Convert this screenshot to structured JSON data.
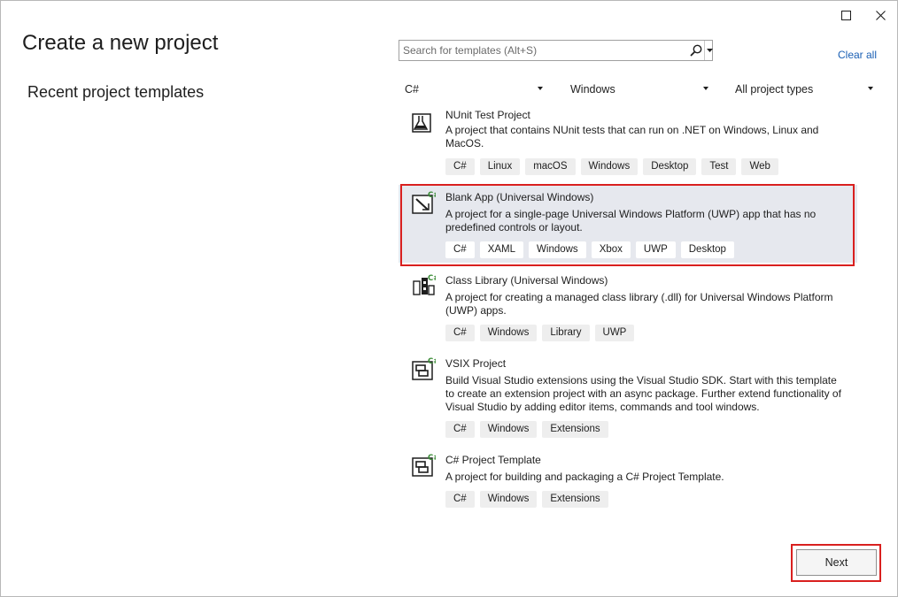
{
  "window": {
    "maximize_icon": "maximize-icon",
    "close_icon": "close-icon"
  },
  "header": {
    "title": "Create a new project"
  },
  "recent": {
    "title": "Recent project templates"
  },
  "search": {
    "placeholder": "Search for templates (Alt+S)",
    "icon": "search-icon"
  },
  "clear_all": "Clear all",
  "filters": {
    "language": "C#",
    "platform": "Windows",
    "project_type": "All project types"
  },
  "templates": [
    {
      "name": "NUnit Test Project",
      "description": "A project that contains NUnit tests that can run on .NET on Windows, Linux and MacOS.",
      "tags": [
        "C#",
        "Linux",
        "macOS",
        "Windows",
        "Desktop",
        "Test",
        "Web"
      ],
      "icon": "flask-icon"
    },
    {
      "name": "Blank App (Universal Windows)",
      "description": "A project for a single-page Universal Windows Platform (UWP) app that has no predefined controls or layout.",
      "tags": [
        "C#",
        "XAML",
        "Windows",
        "Xbox",
        "UWP",
        "Desktop"
      ],
      "icon": "uwp-app-icon",
      "badge": "C#",
      "selected": true
    },
    {
      "name": "Class Library (Universal Windows)",
      "description": "A project for creating a managed class library (.dll) for Universal Windows Platform (UWP) apps.",
      "tags": [
        "C#",
        "Windows",
        "Library",
        "UWP"
      ],
      "icon": "class-library-icon",
      "badge": "C#"
    },
    {
      "name": "VSIX Project",
      "description": "Build Visual Studio extensions using the Visual Studio SDK. Start with this template to create an extension project with an async package. Further extend functionality of Visual Studio by adding editor items, commands and tool windows.",
      "tags": [
        "C#",
        "Windows",
        "Extensions"
      ],
      "icon": "vsix-icon",
      "badge": "C#"
    },
    {
      "name": "C# Project Template",
      "description": "A project for building and packaging a C# Project Template.",
      "tags": [
        "C#",
        "Windows",
        "Extensions"
      ],
      "icon": "project-template-icon",
      "badge": "C#"
    }
  ],
  "footer": {
    "next_label": "Next"
  },
  "colors": {
    "accent_red": "#d9201f",
    "link_blue": "#1a5fb4",
    "selected_bg": "#e6e8ee",
    "csharp_green": "#388a34"
  }
}
